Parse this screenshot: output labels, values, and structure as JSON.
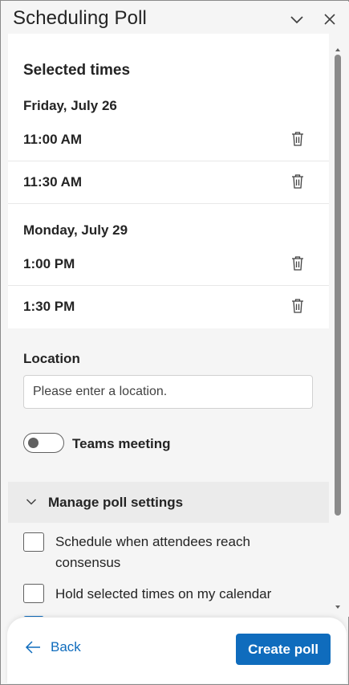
{
  "header": {
    "title": "Scheduling Poll",
    "collapse_icon": "chevron-down-icon",
    "close_icon": "close-icon"
  },
  "selected_times": {
    "title": "Selected times",
    "days": [
      {
        "label": "Friday, July 26",
        "times": [
          "11:00 AM",
          "11:30 AM"
        ]
      },
      {
        "label": "Monday, July 29",
        "times": [
          "1:00 PM",
          "1:30 PM"
        ]
      }
    ],
    "delete_icon": "trash-icon"
  },
  "location": {
    "label": "Location",
    "placeholder": "Please enter a location.",
    "value": ""
  },
  "teams": {
    "label": "Teams meeting",
    "enabled": false
  },
  "poll_settings": {
    "label": "Manage poll settings",
    "expanded": true,
    "options": [
      {
        "label": "Schedule when attendees reach consensus",
        "checked": false
      },
      {
        "label": "Hold selected times on my calendar",
        "checked": false
      },
      {
        "label": "",
        "checked": true
      }
    ]
  },
  "footer": {
    "back_label": "Back",
    "create_label": "Create poll"
  },
  "colors": {
    "accent": "#0f6cbd",
    "panel_bg": "#f5f5f5",
    "card_bg": "#ffffff"
  }
}
